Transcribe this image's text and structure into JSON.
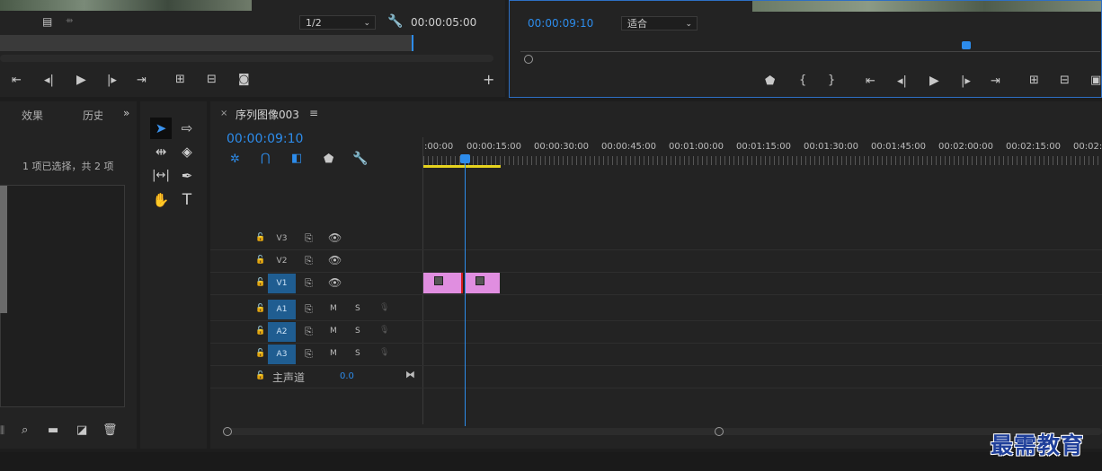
{
  "source_monitor": {
    "resolution": "1/2",
    "duration": "00:00:05:00",
    "controls": [
      "mark-in-icon",
      "step-back-icon",
      "play-icon",
      "step-forward-icon",
      "mark-out-icon",
      "insert-icon",
      "overwrite-icon",
      "camera-icon",
      "add-icon"
    ]
  },
  "program_monitor": {
    "timecode": "00:00:09:10",
    "fit": "适合"
  },
  "left_panel": {
    "tab_effects": "效果",
    "tab_history": "历史",
    "selection_info": "1 项已选择，共 2 项"
  },
  "sequence": {
    "name": "序列图像003",
    "timecode": "00:00:09:10",
    "ruler": [
      ":00:00",
      "00:00:15:00",
      "00:00:30:00",
      "00:00:45:00",
      "00:01:00:00",
      "00:01:15:00",
      "00:01:30:00",
      "00:01:45:00",
      "00:02:00:00",
      "00:02:15:00",
      "00:02:3"
    ],
    "video_tracks": [
      {
        "name": "V3",
        "target": false
      },
      {
        "name": "V2",
        "target": false
      },
      {
        "name": "V1",
        "target": true
      }
    ],
    "audio_tracks": [
      {
        "name": "A1",
        "m": "M",
        "s": "S"
      },
      {
        "name": "A2",
        "m": "M",
        "s": "S"
      },
      {
        "name": "A3",
        "m": "M",
        "s": "S"
      }
    ],
    "master": {
      "label": "主声道",
      "value": "0.0"
    },
    "clip_color": "#e08ee0"
  },
  "watermark": "最需教育"
}
